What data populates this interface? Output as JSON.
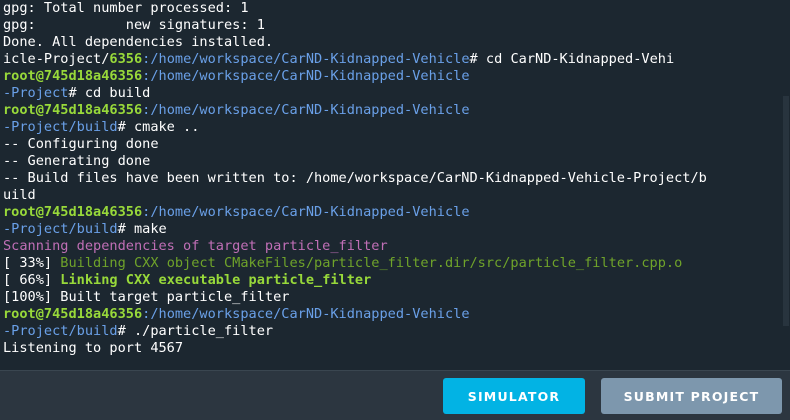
{
  "terminal": {
    "lines": [
      [
        {
          "text": "gpg: Total number processed: 1",
          "color": "white"
        }
      ],
      [
        {
          "text": "gpg:           new signatures: 1",
          "color": "white"
        }
      ],
      [
        {
          "text": "Done. All dependencies installed.",
          "color": "white"
        }
      ],
      [
        {
          "text": "icle-Project/",
          "color": "white"
        },
        {
          "text": "6356",
          "color": "green"
        },
        {
          "text": ":/home/workspace/CarND-Kidnapped-Vehicle",
          "color": "blue"
        },
        {
          "text": "# cd CarND-Kidnapped-Vehi",
          "color": "white"
        }
      ],
      [
        {
          "text": "root@745d18a46356",
          "color": "green"
        },
        {
          "text": ":/home/workspace/CarND-Kidnapped-Vehicle",
          "color": "blue"
        }
      ],
      [
        {
          "text": "-Project",
          "color": "blue"
        },
        {
          "text": "# cd build",
          "color": "white"
        }
      ],
      [
        {
          "text": "root@745d18a46356",
          "color": "green"
        },
        {
          "text": ":/home/workspace/CarND-Kidnapped-Vehicle",
          "color": "blue"
        }
      ],
      [
        {
          "text": "-Project/build",
          "color": "blue"
        },
        {
          "text": "# cmake ..",
          "color": "white"
        }
      ],
      [
        {
          "text": "-- Configuring done",
          "color": "white"
        }
      ],
      [
        {
          "text": "-- Generating done",
          "color": "white"
        }
      ],
      [
        {
          "text": "-- Build files have been written to: /home/workspace/CarND-Kidnapped-Vehicle-Project/b",
          "color": "white"
        }
      ],
      [
        {
          "text": "uild",
          "color": "white"
        }
      ],
      [
        {
          "text": "root@745d18a46356",
          "color": "green"
        },
        {
          "text": ":/home/workspace/CarND-Kidnapped-Vehicle",
          "color": "blue"
        }
      ],
      [
        {
          "text": "-Project/build",
          "color": "blue"
        },
        {
          "text": "# make",
          "color": "white"
        }
      ],
      [
        {
          "text": "Scanning dependencies of target particle_filter",
          "color": "magenta"
        }
      ],
      [
        {
          "text": "[ 33%] ",
          "color": "white"
        },
        {
          "text": "Building CXX object CMakeFiles/particle_filter.dir/src/particle_filter.cpp.o",
          "color": "dimgreen"
        }
      ],
      [
        {
          "text": "[ 66%] ",
          "color": "white"
        },
        {
          "text": "Linking CXX executable particle_filter",
          "color": "boldgreen"
        }
      ],
      [
        {
          "text": "[100%] Built target particle_filter",
          "color": "white"
        }
      ],
      [
        {
          "text": "root@745d18a46356",
          "color": "green"
        },
        {
          "text": ":/home/workspace/CarND-Kidnapped-Vehicle",
          "color": "blue"
        }
      ],
      [
        {
          "text": "-Project/build",
          "color": "blue"
        },
        {
          "text": "# ./particle_filter",
          "color": "white"
        }
      ],
      [
        {
          "text": "Listening to port 4567",
          "color": "white"
        }
      ]
    ]
  },
  "footer": {
    "simulator_label": "SIMULATOR",
    "submit_label": "SUBMIT PROJECT"
  },
  "colors": {
    "terminal_bg": "#1c2730",
    "footer_bg": "#2c3640",
    "simulator_button": "#02b3e4",
    "submit_button": "#7d97ad",
    "prompt_user": "#98d93a",
    "prompt_path": "#6aa0e8",
    "make_scan": "#c06fb6"
  }
}
